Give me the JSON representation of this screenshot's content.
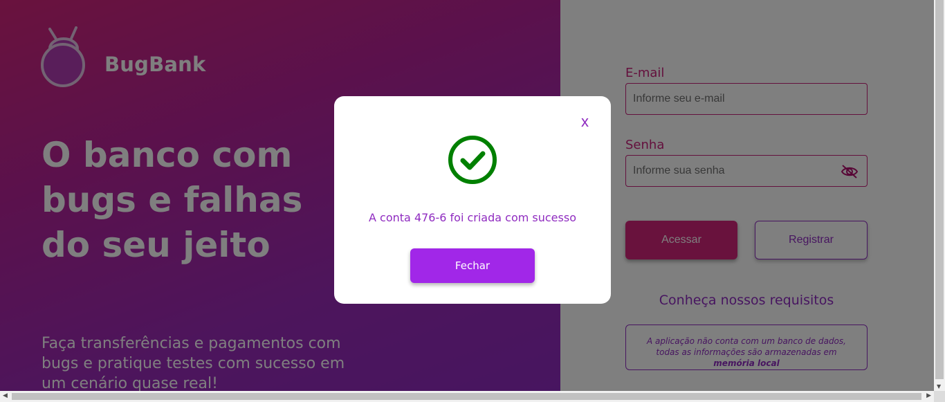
{
  "brand": {
    "name": "BugBank"
  },
  "hero": {
    "headline": "O banco com bugs e falhas do seu jeito",
    "subtext": "Faça transferências e pagamentos com bugs e pratique testes com sucesso em um cenário quase real!"
  },
  "login": {
    "email_label": "E-mail",
    "email_placeholder": "Informe seu e-mail",
    "password_label": "Senha",
    "password_placeholder": "Informe sua senha",
    "access_label": "Acessar",
    "register_label": "Registrar"
  },
  "requirements": {
    "title": "Conheça nossos requisitos",
    "text": "A aplicação não conta com um banco de dados, todas as informações são armazenadas em",
    "text_bold": "memória local"
  },
  "modal": {
    "close_symbol": "x",
    "message": "A conta 476-6 foi criada com sucesso",
    "button_label": "Fechar"
  },
  "colors": {
    "primary": "#d3257b",
    "accent": "#8f2bc0",
    "modal_button": "#a127e8",
    "success": "#008000"
  },
  "icons": [
    "bug-logo-icon",
    "eye-off-icon",
    "success-check-icon",
    "close-icon"
  ]
}
